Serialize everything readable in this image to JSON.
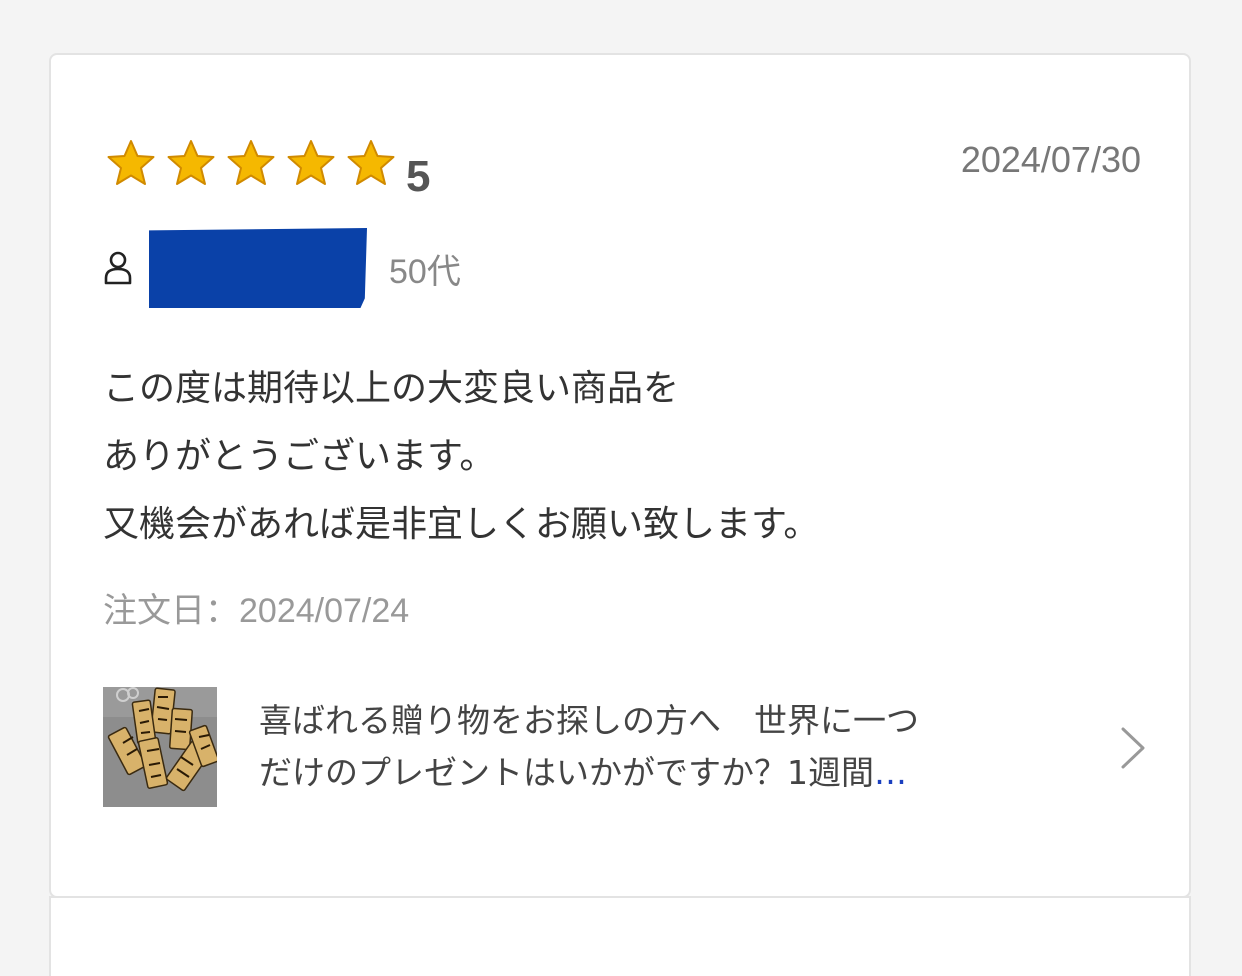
{
  "review": {
    "rating_stars": 5,
    "rating_value": "5",
    "date": "2024/07/30",
    "reviewer": {
      "icon": "user-icon",
      "name_redacted": true,
      "age": "50代"
    },
    "body_lines": [
      "この度は期待以上の大変良い商品を",
      "ありがとうございます。",
      "又機会があれば是非宜しくお願い致します。"
    ],
    "order_date_label": "注文日：",
    "order_date_value": "2024/07/24"
  },
  "product": {
    "title_line1": "喜ばれる贈り物をお探しの方へ　世界に一つ",
    "title_line2": "だけのプレゼントはいかがですか？1週間",
    "ellipsis": "…",
    "chevron_icon": "chevron-right-icon"
  },
  "colors": {
    "star": "#f5b800",
    "star_outline": "#d08a00",
    "redaction": "#0a41a8",
    "ellipsis": "#1a3fbf"
  }
}
